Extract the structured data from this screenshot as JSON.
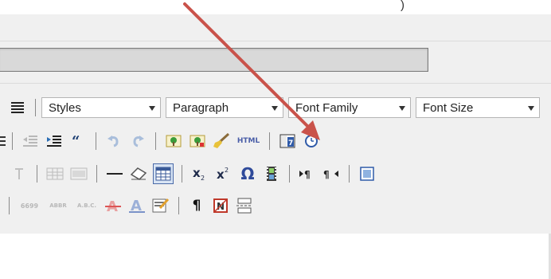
{
  "top_fragment": ")",
  "url_field": {
    "value": ""
  },
  "toolbar": {
    "row1": {
      "styles_label": "Styles",
      "paragraph_label": "Paragraph",
      "font_family_label": "Font Family",
      "font_size_label": "Font Size"
    },
    "row2": {
      "html_label": "HTML"
    },
    "row3": {
      "omega_label": "Ω"
    },
    "row4": {
      "quote_label": "6699",
      "abbr_label": "ABBR",
      "acronym_label": "A.B.C.",
      "pilcrow_label": "¶"
    }
  },
  "colors": {
    "arrow": "#c9524a",
    "toolbar_bg": "#f0f0f0",
    "field_bg": "#d9d9d9"
  }
}
